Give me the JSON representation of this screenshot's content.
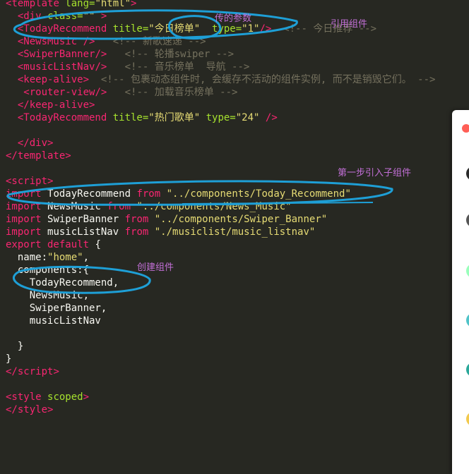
{
  "code_lines": [
    [
      {
        "t": "<",
        "c": "tag"
      },
      {
        "t": "template ",
        "c": "tag"
      },
      {
        "t": "lang=",
        "c": "attr"
      },
      {
        "t": "\"html\"",
        "c": "str"
      },
      {
        "t": ">",
        "c": "tag"
      }
    ],
    [
      {
        "t": "  ",
        "c": "plain"
      },
      {
        "t": "<div ",
        "c": "tag"
      },
      {
        "t": "class=",
        "c": "attr"
      },
      {
        "t": "\"\"",
        "c": "str"
      },
      {
        "t": " >",
        "c": "tag"
      }
    ],
    [
      {
        "t": "  ",
        "c": "plain"
      },
      {
        "t": "<TodayRecommend ",
        "c": "tag"
      },
      {
        "t": "title=",
        "c": "attr"
      },
      {
        "t": "\"今日榜单\"",
        "c": "str"
      },
      {
        "t": "  ",
        "c": "plain"
      },
      {
        "t": "type=",
        "c": "attr"
      },
      {
        "t": "\"1\"",
        "c": "str"
      },
      {
        "t": "/>",
        "c": "tag"
      },
      {
        "t": "  <!-- 今日推荐 -->",
        "c": "comment"
      }
    ],
    [
      {
        "t": "  ",
        "c": "plain"
      },
      {
        "t": "<NewsMusic ",
        "c": "tag"
      },
      {
        "t": "/>",
        "c": "tag"
      },
      {
        "t": "   <!-- 新歌速递 -->",
        "c": "comment"
      }
    ],
    [
      {
        "t": "  ",
        "c": "plain"
      },
      {
        "t": "<SwiperBanner",
        "c": "tag"
      },
      {
        "t": "/>",
        "c": "tag"
      },
      {
        "t": "   <!-- 轮播swiper -->",
        "c": "comment"
      }
    ],
    [
      {
        "t": "  ",
        "c": "plain"
      },
      {
        "t": "<musicListNav",
        "c": "tag"
      },
      {
        "t": "/>",
        "c": "tag"
      },
      {
        "t": "   <!-- 音乐榜单  导航 -->",
        "c": "comment"
      }
    ],
    [
      {
        "t": "  ",
        "c": "plain"
      },
      {
        "t": "<keep-alive",
        "c": "tag"
      },
      {
        "t": ">",
        "c": "tag"
      },
      {
        "t": "  <!-- 包裹动态组件时, 会缓存不活动的组件实例, 而不是销毁它们。 -->",
        "c": "comment"
      }
    ],
    [
      {
        "t": "   ",
        "c": "plain"
      },
      {
        "t": "<router-view",
        "c": "tag"
      },
      {
        "t": "/>",
        "c": "tag"
      },
      {
        "t": "   <!-- 加载音乐榜单 -->",
        "c": "comment"
      }
    ],
    [
      {
        "t": "  ",
        "c": "plain"
      },
      {
        "t": "</keep-alive",
        "c": "tag"
      },
      {
        "t": ">",
        "c": "tag"
      }
    ],
    [
      {
        "t": "  ",
        "c": "plain"
      },
      {
        "t": "<TodayRecommend ",
        "c": "tag"
      },
      {
        "t": "title=",
        "c": "attr"
      },
      {
        "t": "\"热门歌单\"",
        "c": "str"
      },
      {
        "t": " ",
        "c": "plain"
      },
      {
        "t": "type=",
        "c": "attr"
      },
      {
        "t": "\"24\"",
        "c": "str"
      },
      {
        "t": " />",
        "c": "tag"
      }
    ],
    [],
    [
      {
        "t": "  ",
        "c": "plain"
      },
      {
        "t": "</div",
        "c": "tag"
      },
      {
        "t": ">",
        "c": "tag"
      }
    ],
    [
      {
        "t": "</template",
        "c": "tag"
      },
      {
        "t": ">",
        "c": "tag"
      }
    ],
    [],
    [
      {
        "t": "<script",
        "c": "tag"
      },
      {
        "t": ">",
        "c": "tag"
      }
    ],
    [
      {
        "t": "import ",
        "c": "kw"
      },
      {
        "t": "TodayRecommend ",
        "c": "plain"
      },
      {
        "t": "from ",
        "c": "kw"
      },
      {
        "t": "\"../components/Today_Recommend\"",
        "c": "str"
      }
    ],
    [
      {
        "t": "import ",
        "c": "kw"
      },
      {
        "t": "NewsMusic ",
        "c": "plain"
      },
      {
        "t": "from ",
        "c": "kw"
      },
      {
        "t": "\"../components/News_Music\"",
        "c": "str"
      }
    ],
    [
      {
        "t": "import ",
        "c": "kw"
      },
      {
        "t": "SwiperBanner ",
        "c": "plain"
      },
      {
        "t": "from ",
        "c": "kw"
      },
      {
        "t": "\"../components/Swiper_Banner\"",
        "c": "str"
      }
    ],
    [
      {
        "t": "import ",
        "c": "kw"
      },
      {
        "t": "musicListNav ",
        "c": "plain"
      },
      {
        "t": "from ",
        "c": "kw"
      },
      {
        "t": "\"./musiclist/music_listnav\"",
        "c": "str"
      }
    ],
    [
      {
        "t": "export default ",
        "c": "kw"
      },
      {
        "t": "{",
        "c": "plain"
      }
    ],
    [
      {
        "t": "  name:",
        "c": "plain"
      },
      {
        "t": "\"home\"",
        "c": "str"
      },
      {
        "t": ",",
        "c": "plain"
      }
    ],
    [
      {
        "t": "  components:{",
        "c": "plain"
      }
    ],
    [
      {
        "t": "    TodayRecommend,",
        "c": "plain"
      }
    ],
    [
      {
        "t": "    NewsMusic,",
        "c": "plain"
      }
    ],
    [
      {
        "t": "    SwiperBanner,",
        "c": "plain"
      }
    ],
    [
      {
        "t": "    musicListNav",
        "c": "plain"
      }
    ],
    [],
    [
      {
        "t": "  }",
        "c": "plain"
      }
    ],
    [
      {
        "t": "}",
        "c": "plain"
      }
    ],
    [
      {
        "t": "</script",
        "c": "tag"
      },
      {
        "t": ">",
        "c": "tag"
      }
    ],
    [],
    [
      {
        "t": "<style ",
        "c": "tag"
      },
      {
        "t": "scoped",
        "c": "attr"
      },
      {
        "t": ">",
        "c": "tag"
      }
    ],
    [
      {
        "t": "</style",
        "c": "tag"
      },
      {
        "t": ">",
        "c": "tag"
      }
    ]
  ],
  "annotations": {
    "passed_params": "传的参数",
    "reference_component": "引用组件",
    "step1_import": "第一步引入子组件",
    "create_component": "创建组件"
  },
  "colors": {
    "background": "#272822",
    "tag": "#f92672",
    "attribute": "#a6e22e",
    "string": "#e6db74",
    "comment": "#75715e",
    "plain": "#f8f8f2",
    "annotation_text": "#c26fd6",
    "annotation_ink": "#1e9fd6"
  }
}
